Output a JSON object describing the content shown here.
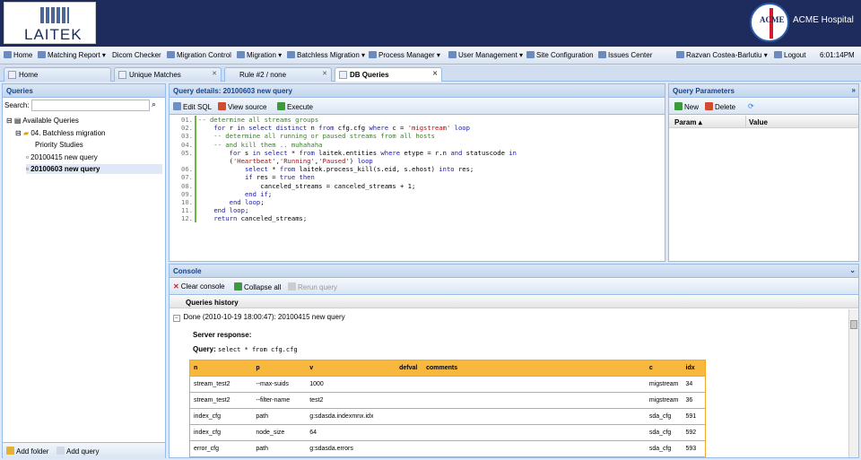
{
  "header": {
    "logo_text": "LAITEK",
    "hospital_name": "ACME Hospital",
    "hospital_logo_text": "ACME"
  },
  "menu": {
    "items": [
      "Home",
      "Matching Report",
      "Dicom Checker",
      "Migration Control",
      "Migration",
      "Batchless Migration",
      "Process Manager",
      "User Management",
      "Site Configuration",
      "Issues Center"
    ],
    "user": "Razvan Costea-Barlutiu",
    "logout": "Logout",
    "time": "6:01:14PM"
  },
  "tabs": [
    "Home",
    "Unique Matches",
    "Rule #2 / none",
    "DB Queries"
  ],
  "queries": {
    "title": "Queries",
    "search_label": "Search:",
    "search_value": "",
    "tree": [
      "Available Queries",
      "04. Batchless migration",
      "Priority Studies",
      "20100415 new query",
      "20100603 new query"
    ],
    "add_folder": "Add folder",
    "add_query": "Add query"
  },
  "details": {
    "title": "Query details: 20100603 new query",
    "edit": "Edit SQL",
    "view": "View source",
    "execute": "Execute",
    "lines": [
      {
        "n": "01.",
        "t": "-- determine all streams groups"
      },
      {
        "n": "02.",
        "t": "    for r in select distinct n from cfg.cfg where c = 'migstream' loop"
      },
      {
        "n": "03.",
        "t": "    -- determine all running or paused streams from all hosts"
      },
      {
        "n": "04.",
        "t": "    -- and kill them .. muhahaha"
      },
      {
        "n": "05.",
        "t": "        for s in select * from laitek.entities where etype = r.n and statuscode in"
      },
      {
        "n": "",
        "t": "        ('Heartbeat','Running','Paused') loop"
      },
      {
        "n": "06.",
        "t": "            select * from laitek.process_kill(s.eid, s.ehost) into res;"
      },
      {
        "n": "07.",
        "t": "            if res = true then"
      },
      {
        "n": "08.",
        "t": "                canceled_streams = canceled_streams + 1;"
      },
      {
        "n": "09.",
        "t": "            end if;"
      },
      {
        "n": "10.",
        "t": "        end loop;"
      },
      {
        "n": "11.",
        "t": "    end loop;"
      },
      {
        "n": "12.",
        "t": "    return canceled_streams;"
      }
    ]
  },
  "params": {
    "title": "Query Parameters",
    "new": "New",
    "delete": "Delete",
    "col_param": "Param",
    "col_value": "Value"
  },
  "console": {
    "title": "Console",
    "clear": "Clear console",
    "collapse": "Collapse all",
    "rerun": "Rerun query",
    "history": "Queries history",
    "entry": "Done (2010-10-19 18:00:47): 20100415 new query",
    "server": "Server response:",
    "query_label": "Query:",
    "query_text": "select * from cfg.cfg",
    "columns": [
      "n",
      "p",
      "v",
      "defval",
      "comments",
      "c",
      "idx"
    ],
    "rows": [
      [
        "stream_test2",
        "--max-suids",
        "1000",
        "",
        "",
        "migstream",
        "34"
      ],
      [
        "stream_test2",
        "--filter-name",
        "test2",
        "",
        "",
        "migstream",
        "36"
      ],
      [
        "index_cfg",
        "path",
        "g:sdasda.indexmnx.idx",
        "",
        "",
        "sda_cfg",
        "591"
      ],
      [
        "index_cfg",
        "node_size",
        "64",
        "",
        "",
        "sda_cfg",
        "592"
      ],
      [
        "error_cfg",
        "path",
        "g:sdasda.errors",
        "",
        "",
        "sda_cfg",
        "593"
      ]
    ]
  }
}
